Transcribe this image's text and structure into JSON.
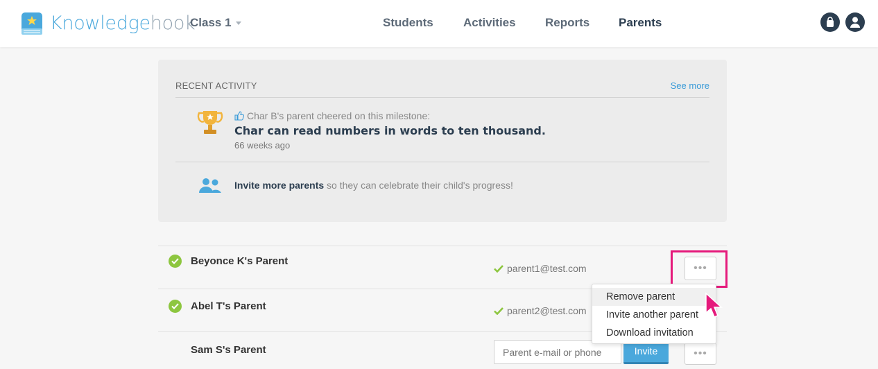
{
  "header": {
    "brand_part1": "Knowledge",
    "brand_part2": "hook",
    "class_selector": "Class 1",
    "nav": [
      "Students",
      "Activities",
      "Reports",
      "Parents"
    ],
    "active_nav": "Parents"
  },
  "recent_activity": {
    "heading": "RECENT ACTIVITY",
    "see_more": "See more",
    "cheer_text": "Char B's parent cheered on this milestone:",
    "milestone": "Char can read numbers in words to ten thousand.",
    "time_ago": "66 weeks ago",
    "invite_bold": "Invite more parents",
    "invite_rest": " so they can celebrate their child's progress!"
  },
  "parents": [
    {
      "name": "Beyonce K's Parent",
      "email": "parent1@test.com",
      "verified": true
    },
    {
      "name": "Abel T's Parent",
      "email": "parent2@test.com",
      "verified": true
    },
    {
      "name": "Sam S's Parent",
      "email": "",
      "verified": false
    }
  ],
  "row_menu": {
    "items": [
      "Remove parent",
      "Invite another parent",
      "Download invitation"
    ],
    "hovered": "Remove parent"
  },
  "invite_form": {
    "placeholder": "Parent e-mail or phone",
    "button": "Invite"
  },
  "more_button_glyph": "•••",
  "colors": {
    "accent": "#4aa8dc",
    "highlight": "#e5197b",
    "verified": "#8dc63f",
    "dark": "#2c3e50"
  }
}
